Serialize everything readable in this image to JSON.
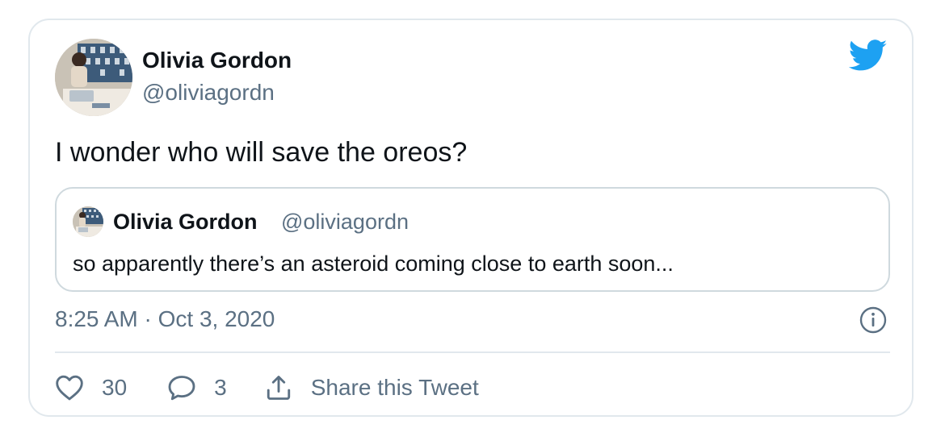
{
  "author": {
    "name": "Olivia Gordon",
    "handle": "@oliviagordn",
    "avatar_icon": "profile-photo"
  },
  "tweet": {
    "text": "I wonder who will save the oreos?"
  },
  "quoted_tweet": {
    "name": "Olivia Gordon",
    "handle": "@oliviagordn",
    "text": "so apparently there’s an asteroid coming close to earth soon..."
  },
  "meta": {
    "timestamp": "8:25 AM · Oct 3, 2020"
  },
  "actions": {
    "like_count": "30",
    "reply_count": "3",
    "share_label": "Share this Tweet"
  },
  "icons": {
    "brand": "twitter-bird-icon",
    "info": "info-icon",
    "like": "heart-icon",
    "reply": "speech-bubble-icon",
    "share": "share-upload-icon"
  },
  "colors": {
    "brand_blue": "#1da1f2",
    "secondary_text": "#5b7083",
    "border": "#e1e8ed"
  }
}
